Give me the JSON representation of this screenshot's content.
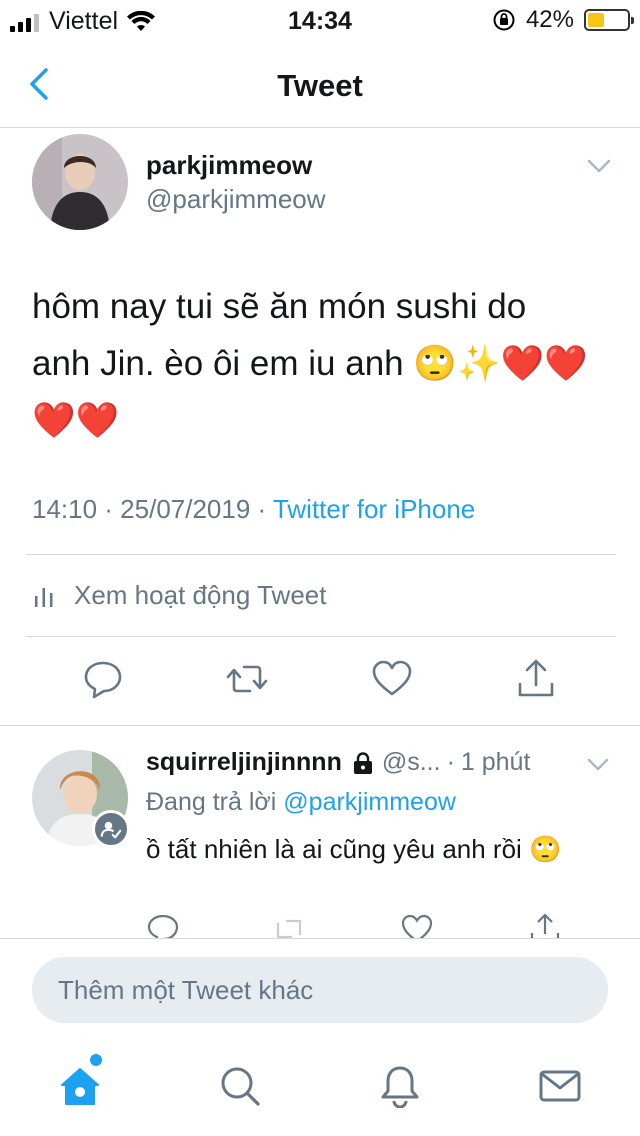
{
  "status_bar": {
    "carrier": "Viettel",
    "time": "14:34",
    "battery_percent_label": "42%",
    "battery_level": 0.42
  },
  "nav": {
    "title": "Tweet"
  },
  "tweet": {
    "author_name": "parkjimmeow",
    "author_handle": "@parkjimmeow",
    "text": "hôm nay tui sẽ ăn món sushi do anh Jin. èo ôi em iu anh 🙄✨❤️❤️❤️❤️",
    "timestamp": "14:10 · 25/07/2019 · ",
    "source": "Twitter for iPhone",
    "activity_label": "Xem hoạt động Tweet"
  },
  "reply": {
    "author_name": "squirreljinjinnnn",
    "author_handle": "@s...",
    "separator": "·",
    "time": "1 phút",
    "replying_prefix": "Đang trả lời ",
    "replying_mention": "@parkjimmeow",
    "text": "ồ tất nhiên là ai cũng yêu anh rồi 🙄"
  },
  "compose": {
    "placeholder": "Thêm một Tweet khác"
  },
  "icons": {
    "accent": "#1da1f2",
    "muted": "#657786"
  }
}
